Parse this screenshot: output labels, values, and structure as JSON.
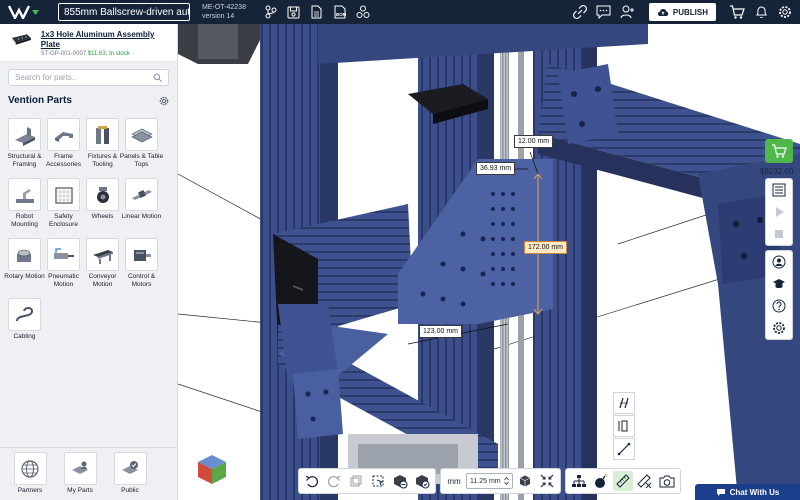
{
  "header": {
    "title": "855mm Ballscrew-driven aut…",
    "project_id": "ME-OT-42238",
    "version": "version 14",
    "publish_label": "PUBLISH"
  },
  "selected_part": {
    "name": "1x3 Hole Aluminum Assembly Plate",
    "sku": "ST-GP-001-0007",
    "price": "$11.63,",
    "stock": "In stock"
  },
  "search": {
    "placeholder": "Search for parts.."
  },
  "library": {
    "title": "Vention Parts",
    "categories": [
      {
        "label": "Structural & Framing",
        "icon": "framing-icon"
      },
      {
        "label": "Frame Accessories",
        "icon": "bracket-icon"
      },
      {
        "label": "Fixtures & Tooling",
        "icon": "fixture-icon"
      },
      {
        "label": "Panels & Table Tops",
        "icon": "panel-icon"
      },
      {
        "label": "Robot Mounting",
        "icon": "robot-icon"
      },
      {
        "label": "Safety Enclosure",
        "icon": "enclosure-icon"
      },
      {
        "label": "Wheels",
        "icon": "wheel-icon"
      },
      {
        "label": "Linear Motion",
        "icon": "linear-icon"
      },
      {
        "label": "Rotary Motion",
        "icon": "rotary-icon"
      },
      {
        "label": "Pneumatic Motion",
        "icon": "pneumatic-icon"
      },
      {
        "label": "Conveyor Motion",
        "icon": "conveyor-icon"
      },
      {
        "label": "Control & Motors",
        "icon": "motor-icon"
      },
      {
        "label": "Cabling",
        "icon": "cable-icon"
      }
    ],
    "bottom_tabs": [
      {
        "label": "Partners",
        "icon": "globe-icon"
      },
      {
        "label": "My Parts",
        "icon": "user-parts-icon"
      },
      {
        "label": "Public",
        "icon": "public-icon"
      }
    ]
  },
  "viewport": {
    "dimensions": [
      {
        "label": "12.00 mm",
        "active": false
      },
      {
        "label": "36.93 mm",
        "active": false
      },
      {
        "label": "172.00 mm",
        "active": true
      },
      {
        "label": "123.00 mm",
        "active": false
      }
    ]
  },
  "cart": {
    "total": "$8232.60"
  },
  "toolbar": {
    "grid_unit": "mm",
    "grid_value": "11.25 mm"
  },
  "chat": {
    "label": "Chat With Us"
  },
  "colors": {
    "nav_bg": "#16243a",
    "accent_green": "#4fb84a",
    "frame_blue": "#3b4f8a",
    "dimension_highlight": "#e3a45a",
    "chat_blue": "#1a3e8c"
  }
}
